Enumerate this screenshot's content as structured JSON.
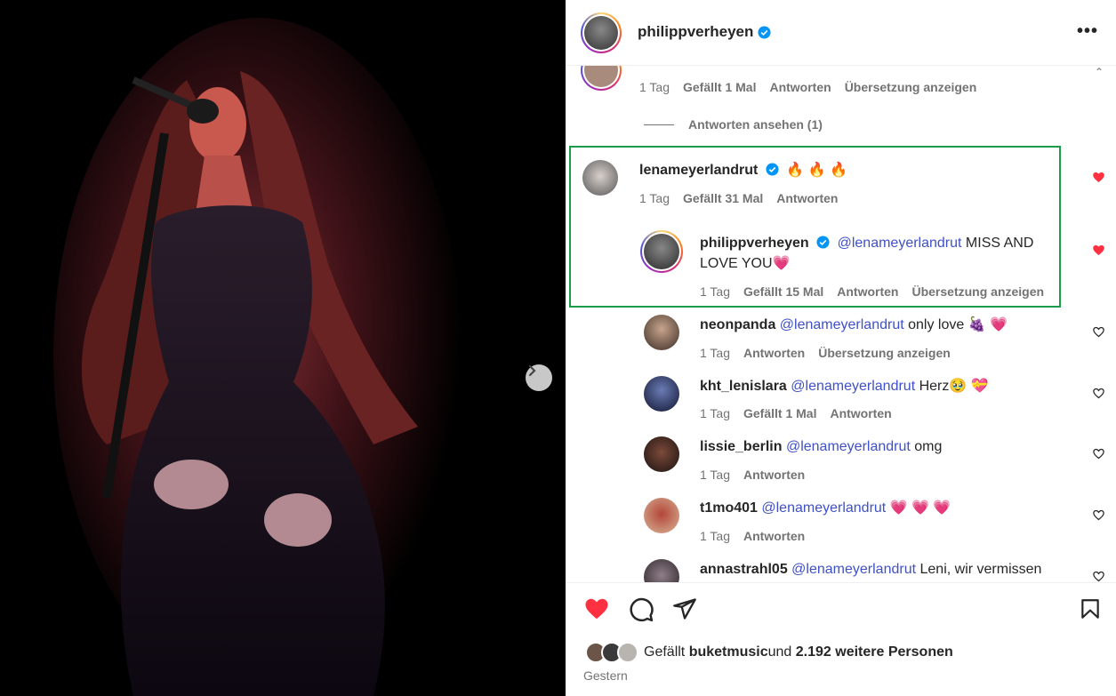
{
  "post": {
    "username": "philippverheyen",
    "more_icon": "more-horizontal-icon"
  },
  "comments": {
    "first": {
      "time": "1 Tag",
      "likes": "Gefällt 1 Mal",
      "reply": "Antworten",
      "translate": "Übersetzung anzeigen"
    },
    "view_replies": "Antworten ansehen (1)",
    "highlighted": {
      "username": "lenameyerlandrut",
      "text": "🔥 🔥 🔥",
      "time": "1 Tag",
      "likes": "Gefällt 31 Mal",
      "reply": "Antworten",
      "liked": true
    },
    "reply": {
      "username": "philippverheyen",
      "mention": "@lenameyerlandrut",
      "text_line1": " MISS AND",
      "text_line2": "LOVE YOU💗",
      "time": "1 Tag",
      "likes": "Gefällt 15 Mal",
      "reply": "Antworten",
      "translate": "Übersetzung anzeigen",
      "liked": true
    },
    "list": [
      {
        "username": "neonpanda",
        "mention": "@lenameyerlandrut",
        "text": " only love  🍇 💗",
        "time": "1 Tag",
        "likes": "",
        "reply": "Antworten",
        "translate": "Übersetzung anzeigen"
      },
      {
        "username": "kht_lenislara",
        "mention": "@lenameyerlandrut",
        "text": " Herz🥹 💝",
        "time": "1 Tag",
        "likes": "Gefällt 1 Mal",
        "reply": "Antworten",
        "translate": ""
      },
      {
        "username": "lissie_berlin",
        "mention": "@lenameyerlandrut",
        "text": " omg",
        "time": "1 Tag",
        "likes": "",
        "reply": "Antworten",
        "translate": ""
      },
      {
        "username": "t1mo401",
        "mention": "@lenameyerlandrut",
        "text": " 💗 💗 💗",
        "time": "1 Tag",
        "likes": "",
        "reply": "Antworten",
        "translate": ""
      },
      {
        "username": "annastrahl05",
        "mention": "@lenameyerlandrut",
        "text": " Leni, wir vermissen",
        "time": "",
        "likes": "",
        "reply": "",
        "translate": ""
      }
    ]
  },
  "footer": {
    "likes_prefix": "Gefällt ",
    "likes_user": "buketmusic",
    "likes_mid": " und ",
    "likes_count": "2.192 weitere Personen",
    "date": "Gestern"
  },
  "colors": {
    "like_red": "#ff3040",
    "mention_blue": "#3f51c6",
    "highlight_green": "#1a9c4a",
    "verified_blue": "#0095f6"
  }
}
